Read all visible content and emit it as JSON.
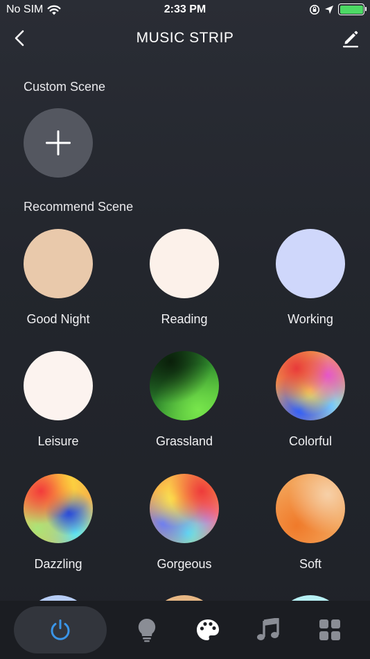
{
  "status_bar": {
    "carrier": "No SIM",
    "time": "2:33 PM",
    "battery_color": "#4cd964"
  },
  "header": {
    "title": "MUSIC STRIP",
    "back_icon": "chevron-left-icon",
    "edit_icon": "pencil-icon"
  },
  "custom_section": {
    "label": "Custom Scene",
    "add_icon": "plus-icon"
  },
  "recommend_section": {
    "label": "Recommend Scene",
    "scenes": [
      {
        "label": "Good Night"
      },
      {
        "label": "Reading"
      },
      {
        "label": "Working"
      },
      {
        "label": "Leisure"
      },
      {
        "label": "Grassland"
      },
      {
        "label": "Colorful"
      },
      {
        "label": "Dazzling"
      },
      {
        "label": "Gorgeous"
      },
      {
        "label": "Soft"
      }
    ]
  },
  "tabbar": {
    "active_tab": "power",
    "active_color": "#3a95e8",
    "tabs": [
      "power-icon",
      "bulb-icon",
      "palette-icon",
      "music-note-icon",
      "grid-icon"
    ]
  }
}
